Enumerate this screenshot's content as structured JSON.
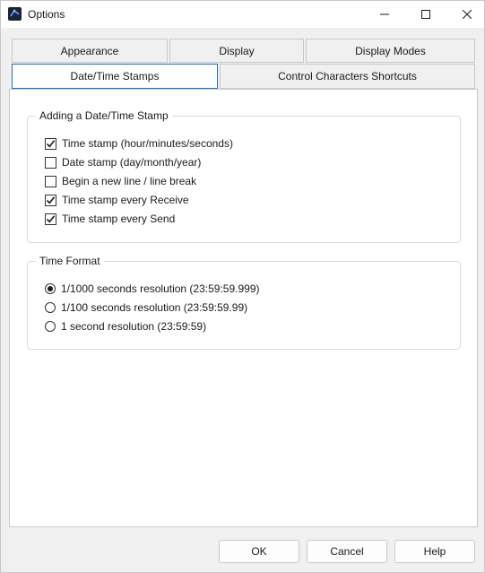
{
  "window": {
    "title": "Options"
  },
  "tabs": {
    "row1": [
      {
        "label": "Appearance"
      },
      {
        "label": "Display"
      },
      {
        "label": "Display Modes"
      }
    ],
    "row2": [
      {
        "label": "Date/Time Stamps",
        "active": true
      },
      {
        "label": "Control Characters Shortcuts"
      }
    ]
  },
  "stamp_group": {
    "title": "Adding a Date/Time Stamp",
    "options": [
      {
        "label": "Time stamp (hour/minutes/seconds)",
        "checked": true
      },
      {
        "label": "Date stamp (day/month/year)",
        "checked": false
      },
      {
        "label": "Begin a new line / line break",
        "checked": false
      },
      {
        "label": "Time stamp every Receive",
        "checked": true
      },
      {
        "label": "Time stamp every Send",
        "checked": true
      }
    ]
  },
  "format_group": {
    "title": "Time Format",
    "options": [
      {
        "label": "1/1000 seconds resolution (23:59:59.999)",
        "selected": true
      },
      {
        "label": "1/100 seconds resolution (23:59:59.99)",
        "selected": false
      },
      {
        "label": "1 second resolution (23:59:59)",
        "selected": false
      }
    ]
  },
  "buttons": {
    "ok": "OK",
    "cancel": "Cancel",
    "help": "Help"
  },
  "icons": {
    "app": "app-icon",
    "minimize": "minimize-icon",
    "maximize": "maximize-icon",
    "close": "close-icon",
    "check": "check-icon"
  },
  "colors": {
    "accent": "#1f6fbf",
    "title_bg": "#ffffff",
    "dialog_bg": "#f0f0f0"
  }
}
